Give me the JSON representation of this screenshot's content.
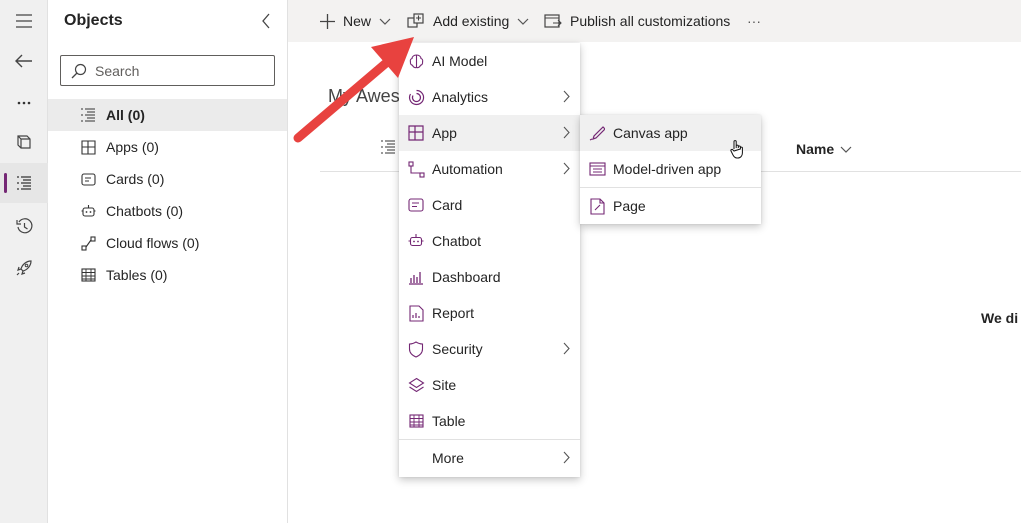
{
  "rail": {
    "items": [
      {
        "icon": "hamburger-icon"
      },
      {
        "icon": "back-arrow-icon"
      },
      {
        "icon": "more-icon"
      },
      {
        "icon": "book-icon"
      },
      {
        "icon": "objects-list-icon",
        "active": true
      },
      {
        "icon": "history-icon"
      },
      {
        "icon": "rocket-icon"
      }
    ]
  },
  "panel": {
    "title": "Objects",
    "search_label": "Search",
    "items": [
      {
        "label": "All",
        "count": "(0)",
        "icon": "list-icon"
      },
      {
        "label": "Apps",
        "count": "(0)",
        "icon": "apps-icon"
      },
      {
        "label": "Cards",
        "count": "(0)",
        "icon": "card-icon"
      },
      {
        "label": "Chatbots",
        "count": "(0)",
        "icon": "chatbot-icon"
      },
      {
        "label": "Cloud flows",
        "count": "(0)",
        "icon": "flow-icon"
      },
      {
        "label": "Tables",
        "count": "(0)",
        "icon": "table-icon"
      }
    ]
  },
  "toolbar": {
    "new_label": "New",
    "add_existing_label": "Add existing",
    "publish_label": "Publish all customizations",
    "more_label": "···"
  },
  "main": {
    "title": "My Awes",
    "column_name": "Name",
    "empty_text": "We di"
  },
  "menu": {
    "items": [
      {
        "label": "AI Model",
        "icon": "ai-model-icon",
        "submenu": false
      },
      {
        "label": "Analytics",
        "icon": "analytics-icon",
        "submenu": true
      },
      {
        "label": "App",
        "icon": "app-icon",
        "submenu": true,
        "hover": true
      },
      {
        "label": "Automation",
        "icon": "automation-icon",
        "submenu": true
      },
      {
        "label": "Card",
        "icon": "card-icon",
        "submenu": false
      },
      {
        "label": "Chatbot",
        "icon": "chatbot-icon",
        "submenu": false
      },
      {
        "label": "Dashboard",
        "icon": "dashboard-icon",
        "submenu": false
      },
      {
        "label": "Report",
        "icon": "report-icon",
        "submenu": false
      },
      {
        "label": "Security",
        "icon": "shield-icon",
        "submenu": true
      },
      {
        "label": "Site",
        "icon": "site-icon",
        "submenu": false
      },
      {
        "label": "Table",
        "icon": "table-icon",
        "submenu": false
      }
    ],
    "more_label": "More"
  },
  "submenu": {
    "items": [
      {
        "label": "Canvas app",
        "icon": "canvas-app-icon"
      },
      {
        "label": "Model-driven app",
        "icon": "model-driven-app-icon"
      },
      {
        "label": "Page",
        "icon": "page-icon"
      }
    ]
  },
  "colors": {
    "accent": "#742774",
    "arrow": "#e8423f"
  }
}
